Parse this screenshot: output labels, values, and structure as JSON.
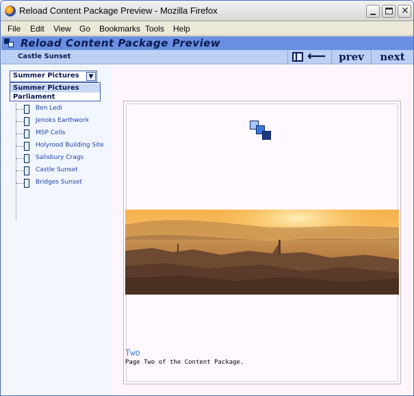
{
  "window": {
    "title": "Reload Content Package Preview - Mozilla Firefox",
    "controls": {
      "close_glyph": "✕"
    }
  },
  "menubar": {
    "items": [
      "File",
      "Edit",
      "View",
      "Go",
      "Bookmarks",
      "Tools",
      "Help"
    ]
  },
  "package": {
    "header_title": "Reload Content Package Preview",
    "current_page": "Castle Sunset",
    "nav": {
      "back_glyph": "⟵",
      "prev_label": "prev",
      "next_label": "next"
    }
  },
  "organization_select": {
    "value": "Summer Pictures",
    "options": [
      "Summer Pictures",
      "Parliament"
    ],
    "arrow_glyph": "▼"
  },
  "toc": {
    "items": [
      "Ben Ledi",
      "Jenoks Earthwork",
      "MSP Cells",
      "Holyrood Building Site",
      "Salisbury Crags",
      "Castle Sunset",
      "Bridges Sunset"
    ]
  },
  "content": {
    "heading": "Two",
    "text": "Page Two of the Content Package.",
    "image": "castle-sunset-photo"
  },
  "colors": {
    "banner": "#6a8fe0",
    "nav_strip": "#bcd0f4",
    "accent_dark": "#0a1a50",
    "link": "#1f3fa8",
    "heading": "#3a7ad8"
  }
}
